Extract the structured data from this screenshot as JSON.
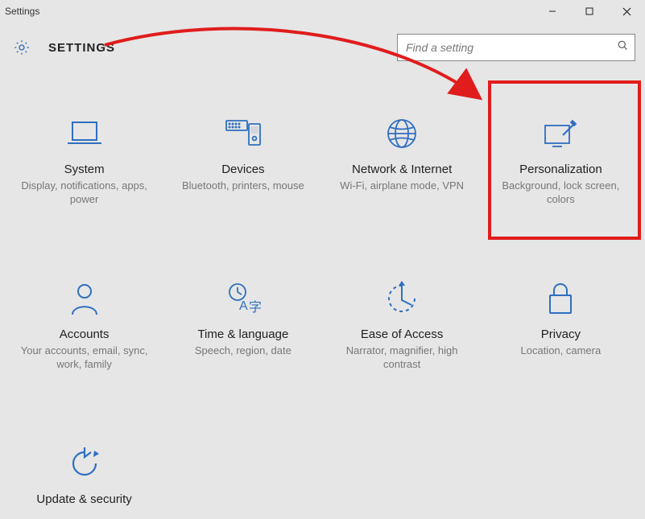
{
  "window": {
    "title": "Settings"
  },
  "header": {
    "title": "SETTINGS"
  },
  "search": {
    "placeholder": "Find a setting"
  },
  "tiles": [
    {
      "title": "System",
      "desc": "Display, notifications, apps, power"
    },
    {
      "title": "Devices",
      "desc": "Bluetooth, printers, mouse"
    },
    {
      "title": "Network & Internet",
      "desc": "Wi-Fi, airplane mode, VPN"
    },
    {
      "title": "Personalization",
      "desc": "Background, lock screen, colors"
    },
    {
      "title": "Accounts",
      "desc": "Your accounts, email, sync, work, family"
    },
    {
      "title": "Time & language",
      "desc": "Speech, region, date"
    },
    {
      "title": "Ease of Access",
      "desc": "Narrator, magnifier, high contrast"
    },
    {
      "title": "Privacy",
      "desc": "Location, camera"
    },
    {
      "title": "Update & security",
      "desc": ""
    }
  ]
}
